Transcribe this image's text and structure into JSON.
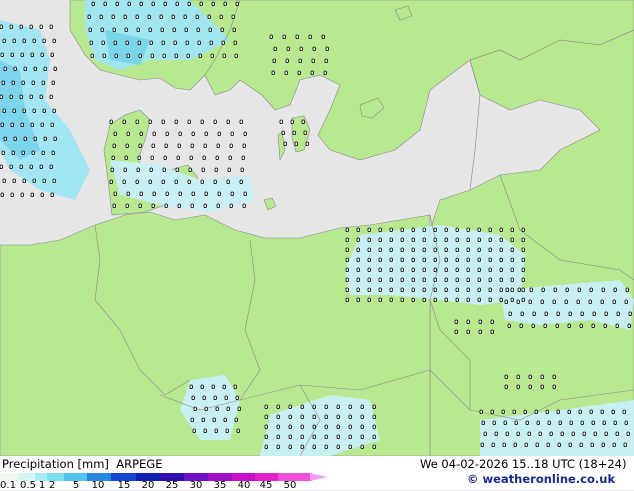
{
  "map": {
    "title": "Precipitation [mm] ARPEGE",
    "colors": {
      "sea": "#e6e6e6",
      "land": "#b8e890",
      "border": "#8a8a8a",
      "precip_light": "#c8f0f8",
      "precip_medium": "#a0e6f4",
      "precip_heavy": "#78d4ee"
    }
  },
  "footer": {
    "label": "Precipitation [mm]",
    "model": "ARPEGE",
    "datetime": "We 04-02-2026 15..18 UTC (18+24)",
    "copyright": "© weatheronline.co.uk",
    "scale": [
      {
        "label": "0.1",
        "color": "#f0fcf0"
      },
      {
        "label": "0.5",
        "color": "#d8f6f8"
      },
      {
        "label": "1",
        "color": "#a8ecf4"
      },
      {
        "label": "2",
        "color": "#80dcf0"
      },
      {
        "label": "5",
        "color": "#50c4ec"
      },
      {
        "label": "10",
        "color": "#2888e0"
      },
      {
        "label": "15",
        "color": "#1448d0"
      },
      {
        "label": "20",
        "color": "#1020b0"
      },
      {
        "label": "25",
        "color": "#3010a8"
      },
      {
        "label": "30",
        "color": "#7010c0"
      },
      {
        "label": "35",
        "color": "#a010c8"
      },
      {
        "label": "40",
        "color": "#c810c8"
      },
      {
        "label": "45",
        "color": "#e020c8"
      },
      {
        "label": "50",
        "color": "#f050d8"
      }
    ]
  }
}
